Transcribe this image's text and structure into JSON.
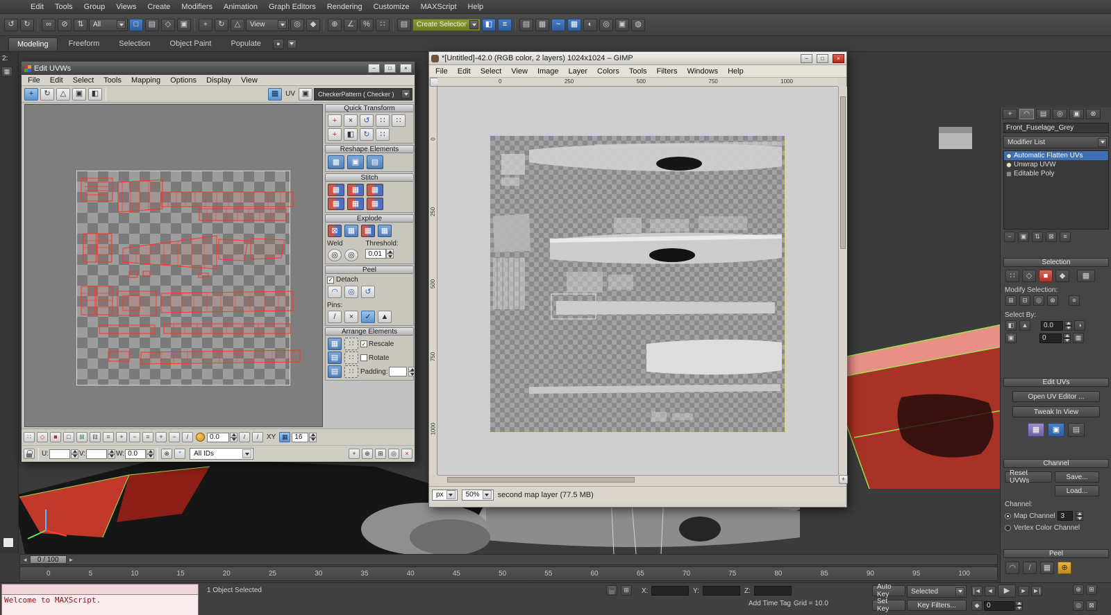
{
  "app": {
    "menubar": [
      "Edit",
      "Tools",
      "Group",
      "Views",
      "Create",
      "Modifiers",
      "Animation",
      "Graph Editors",
      "Rendering",
      "Customize",
      "MAXScript",
      "Help"
    ],
    "toolbar": {
      "filter": "All",
      "view": "View",
      "named_selection": "Create Selection Se"
    },
    "ribbon": [
      "Modeling",
      "Freeform",
      "Selection",
      "Object Paint",
      "Populate"
    ],
    "listener_line": "2:"
  },
  "uvw": {
    "title": "Edit UVWs",
    "menu": [
      "File",
      "Edit",
      "Select",
      "Tools",
      "Mapping",
      "Options",
      "Display",
      "View"
    ],
    "toolbar": {
      "uv_label": "UV",
      "pattern": "CheckerPattern  ( Checker )"
    },
    "rollouts": {
      "quick_transform": "Quick Transform",
      "reshape": "Reshape Elements",
      "stitch": "Stitch",
      "explode": "Explode",
      "weld": "Weld",
      "threshold_label": "Threshold:",
      "threshold_value": "0.01",
      "peel": "Peel",
      "detach": "Detach",
      "pins": "Pins:",
      "arrange": "Arrange Elements",
      "rescale": "Rescale",
      "rotate": "Rotate",
      "padding": "Padding:"
    },
    "bottom": {
      "soft_value": "0.0",
      "xy": "XY",
      "grid_size": "16",
      "u": "U:",
      "v": "V:",
      "w": "W:",
      "w_value": "0.0",
      "all_ids": "All IDs"
    }
  },
  "gimp": {
    "title": "*[Untitled]-42.0 (RGB color, 2 layers) 1024x1024 – GIMP",
    "menu": [
      "File",
      "Edit",
      "Select",
      "View",
      "Image",
      "Layer",
      "Colors",
      "Tools",
      "Filters",
      "Windows",
      "Help"
    ],
    "ruler": [
      "0",
      "250",
      "500",
      "750",
      "1000"
    ],
    "status": {
      "unit": "px",
      "zoom": "50%",
      "message": "second map layer (77.5 MB)"
    }
  },
  "panel": {
    "object_name": "Front_Fuselage_Grey",
    "modifier_list": "Modifier List",
    "stack": [
      "Automatic Flatten UVs",
      "Unwrap UVW",
      "Editable Poly"
    ],
    "selection": {
      "header": "Selection",
      "modify": "Modify Selection:",
      "select_by": "Select By:",
      "angle_value": "0.0",
      "id_value": "0"
    },
    "edit_uvs": {
      "header": "Edit UVs",
      "open_editor": "Open UV Editor ...",
      "tweak": "Tweak In View"
    },
    "channel": {
      "header": "Channel",
      "reset": "Reset UVWs",
      "save": "Save...",
      "load": "Load...",
      "label": "Channel:",
      "map_channel": "Map Channel",
      "map_value": "3",
      "vertex_color": "Vertex Color Channel"
    },
    "peel_header": "Peel"
  },
  "timeline": {
    "range": "0 / 100",
    "ticks": [
      "0",
      "5",
      "10",
      "15",
      "20",
      "25",
      "30",
      "35",
      "40",
      "45",
      "50",
      "55",
      "60",
      "65",
      "70",
      "75",
      "80",
      "85",
      "90",
      "95",
      "100"
    ]
  },
  "status": {
    "listener_text": "Welcome to MAXScript.",
    "object_selected": "1 Object Selected",
    "x": "X:",
    "y": "Y:",
    "z": "Z:",
    "grid": "Grid = 10.0",
    "add_time_tag": "Add Time Tag",
    "auto_key": "Auto Key",
    "selected_mode": "Selected",
    "set_key": "Set Key",
    "key_filters": "Key Filters...",
    "frame": "0"
  },
  "icons": {
    "undo": "↺",
    "redo": "↻",
    "link": "∞",
    "unlink": "⊘",
    "bind": "⇅",
    "select": "□",
    "byname": "▤",
    "fence": "◇",
    "window": "▣",
    "move": "+",
    "rotate": "↻",
    "scale": "△",
    "target": "◎",
    "diam": "◆",
    "snap": "⊕",
    "asnap": "∠",
    "psnap": "%",
    "dots": "∷",
    "mirror": "◧",
    "align": "≡",
    "layers": "▤",
    "grid": "▦",
    "curve": "~",
    "schem": "▦",
    "mat": "◐",
    "rsetup": "◎",
    "rframe": "▣",
    "render": "◍",
    "minus": "−",
    "x": "×",
    "plus": "+",
    "slash": "/",
    "dot": "●",
    "check": "✓",
    "ast": "*",
    "bplus": "⊞",
    "bminus": "⊟",
    "bx": "⊠",
    "ring": "◎",
    "cx": "⊗",
    "vert": "∷",
    "edge": "◇",
    "face": "■",
    "elem": "◆",
    "tri": "▲",
    "arc": "◠",
    "halfr": "◑",
    "back": "◄",
    "play": "▶",
    "fwd": "►",
    "prevk": "|◄",
    "nextk": "►|"
  }
}
